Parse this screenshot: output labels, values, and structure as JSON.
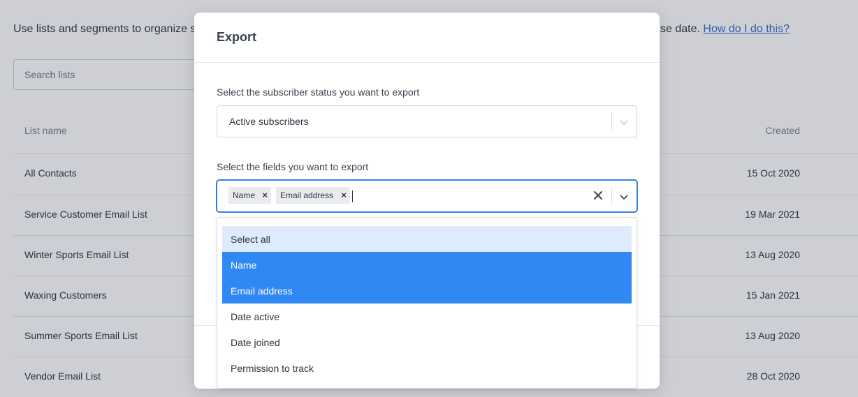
{
  "page": {
    "intro_start": "Use lists and segments to organize s",
    "intro_end": "se date.",
    "help_link": "How do I do this?",
    "search_placeholder": "Search lists",
    "table": {
      "col_name": "List name",
      "col_created": "Created",
      "rows": [
        {
          "name": "All Contacts",
          "created": "15 Oct 2020"
        },
        {
          "name": "Service Customer Email List",
          "created": "19 Mar 2021"
        },
        {
          "name": "Winter Sports Email List",
          "created": "13 Aug 2020"
        },
        {
          "name": "Waxing Customers",
          "created": "15 Jan 2021"
        },
        {
          "name": "Summer Sports Email List",
          "created": "13 Aug 2020"
        },
        {
          "name": "Vendor Email List",
          "created": "28 Oct 2020"
        }
      ]
    }
  },
  "modal": {
    "title": "Export",
    "status_label": "Select the subscriber status you want to export",
    "status_value": "Active subscribers",
    "fields_label": "Select the fields you want to export",
    "selected_fields": [
      "Name",
      "Email address"
    ],
    "chip_remove": "×",
    "options": [
      "Select all",
      "Name",
      "Email address",
      "Date active",
      "Date joined",
      "Permission to track"
    ],
    "highlighted_option": "Select all",
    "selected_options": [
      "Name",
      "Email address"
    ]
  },
  "colors": {
    "accent": "#2f88f3",
    "hover": "#deebfc",
    "link": "#2f6fd4"
  },
  "icons": {
    "chevron": "chevron-down-icon",
    "clear": "clear-icon"
  }
}
